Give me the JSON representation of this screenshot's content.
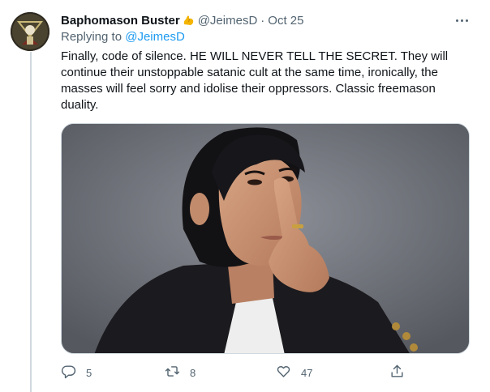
{
  "tweet": {
    "display_name": "Baphomason Buster",
    "name_emoji": "flexed-biceps-emoji",
    "handle": "@JeimesD",
    "separator": "·",
    "date": "Oct 25",
    "replying_to_label": "Replying to",
    "replying_to_handle": "@JeimesD",
    "text": "Finally, code of silence. HE WILL NEVER TELL THE SECRET. They will continue their unstoppable satanic cult at the same time, ironically, the masses will feel sorry and idolise their oppressors. Classic freemason duality.",
    "media": "photo-man-finger-to-lips"
  },
  "actions": {
    "reply_count": "5",
    "retweet_count": "8",
    "like_count": "47"
  },
  "icons": {
    "more": "more-icon",
    "reply": "reply-icon",
    "retweet": "retweet-icon",
    "like": "like-icon",
    "share": "share-icon"
  },
  "colors": {
    "link": "#1d9bf0",
    "secondary_text": "#536471",
    "primary_text": "#0f1419",
    "divider": "#cfd9de"
  }
}
